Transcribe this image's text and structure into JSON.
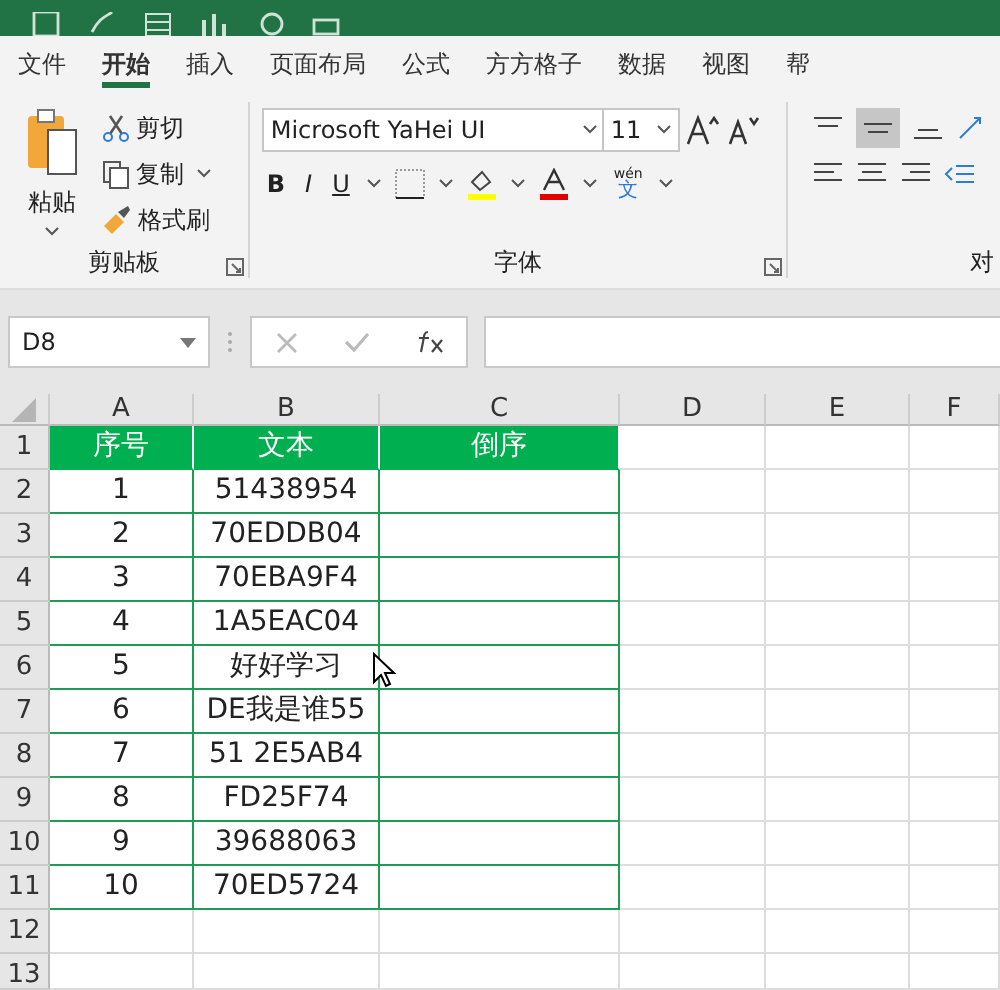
{
  "tabs": [
    {
      "label": "文件",
      "selected": false
    },
    {
      "label": "开始",
      "selected": true
    },
    {
      "label": "插入",
      "selected": false
    },
    {
      "label": "页面布局",
      "selected": false
    },
    {
      "label": "公式",
      "selected": false
    },
    {
      "label": "方方格子",
      "selected": false
    },
    {
      "label": "数据",
      "selected": false
    },
    {
      "label": "视图",
      "selected": false
    },
    {
      "label": "帮",
      "selected": false
    }
  ],
  "clipboard": {
    "label": "剪贴板",
    "paste": "粘贴",
    "cut": "剪切",
    "copy": "复制",
    "format_painter": "格式刷"
  },
  "font": {
    "label": "字体",
    "font_name": "Microsoft YaHei UI",
    "font_size": "11",
    "bold": "B",
    "italic": "I",
    "underline": "U",
    "phonetic_top": "wén",
    "phonetic_bottom": "文"
  },
  "alignment": {
    "label": "对"
  },
  "name_box": "D8",
  "column_headers": [
    "A",
    "B",
    "C",
    "D",
    "E",
    "F"
  ],
  "row_numbers": [
    "1",
    "2",
    "3",
    "4",
    "5",
    "6",
    "7",
    "8",
    "9",
    "10",
    "11",
    "12",
    "13"
  ],
  "table": {
    "columns": [
      "序号",
      "文本",
      "倒序"
    ],
    "rows": [
      [
        "1",
        "51438954",
        ""
      ],
      [
        "2",
        "70EDDB04",
        ""
      ],
      [
        "3",
        "70EBA9F4",
        ""
      ],
      [
        "4",
        "1A5EAC04",
        ""
      ],
      [
        "5",
        "好好学习",
        ""
      ],
      [
        "6",
        "DE我是谁55",
        ""
      ],
      [
        "7",
        "51 2E5AB4",
        ""
      ],
      [
        "8",
        "FD25F74",
        ""
      ],
      [
        "9",
        "39688063",
        ""
      ],
      [
        "10",
        "70ED5724",
        ""
      ]
    ]
  }
}
